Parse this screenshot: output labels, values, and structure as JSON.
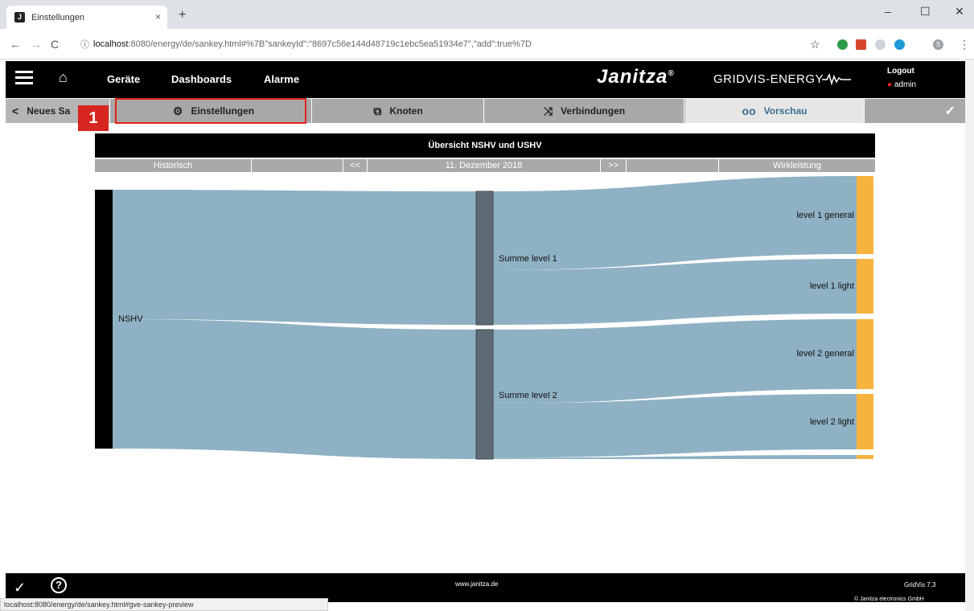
{
  "browser": {
    "tab_title": "Einstellungen",
    "tab_close": "×",
    "new_tab": "+",
    "url_host": "localhost",
    "url_path": ":8080/energy/de/sankey.html#%7B\"sankeyId\":\"8697c56e144d48719c1ebc5ea51934e7\",\"add\":true%7D",
    "status_url": "localhost:8080/energy/de/sankey.html#gve-sankey-preview",
    "profile_initial": "S"
  },
  "appbar": {
    "menu": [
      "Geräte",
      "Dashboards",
      "Alarme"
    ],
    "brand": "Janitza",
    "brand_sup": "®",
    "brand_product": "GRIDVIS-ENERGY",
    "logout": "Logout",
    "user": "admin"
  },
  "apptabs": {
    "first": "Neues Sa",
    "einstellungen": "Einstellungen",
    "knoten": "Knoten",
    "verbindungen": "Verbindungen",
    "vorschau": "Vorschau"
  },
  "step_badge": "1",
  "chart": {
    "title": "Übersicht NSHV und USHV",
    "mode": "Historisch",
    "prev": "<<",
    "date": "11. Dezember 2018",
    "next": ">>",
    "measure": "Wirkleistung"
  },
  "chart_data": {
    "type": "sankey",
    "nodes": [
      "NSHV",
      "Summe level 1",
      "Summe level 2",
      "level 1 general",
      "level 1 light",
      "level 2 general",
      "level 2 light"
    ],
    "links": [
      {
        "source": "NSHV",
        "target": "Summe level 1",
        "value": 1.0
      },
      {
        "source": "NSHV",
        "target": "Summe level 2",
        "value": 1.0
      },
      {
        "source": "Summe level 1",
        "target": "level 1 general",
        "value": 0.59
      },
      {
        "source": "Summe level 1",
        "target": "level 1 light",
        "value": 0.41
      },
      {
        "source": "Summe level 2",
        "target": "level 2 general",
        "value": 0.57
      },
      {
        "source": "Summe level 2",
        "target": "level 2 light",
        "value": 0.42
      },
      {
        "source": "Summe level 2",
        "target": "(unlabeled)",
        "value": 0.01
      }
    ],
    "colors": {
      "source": "#000000",
      "intermediate": "#5d6b74",
      "leaf": "#f6b33e",
      "link": "#8fb1c4"
    }
  },
  "footer": {
    "site": "www.janitza.de",
    "version": "GridVis 7.3",
    "copyright": "© Janitza electronics GmbH"
  }
}
